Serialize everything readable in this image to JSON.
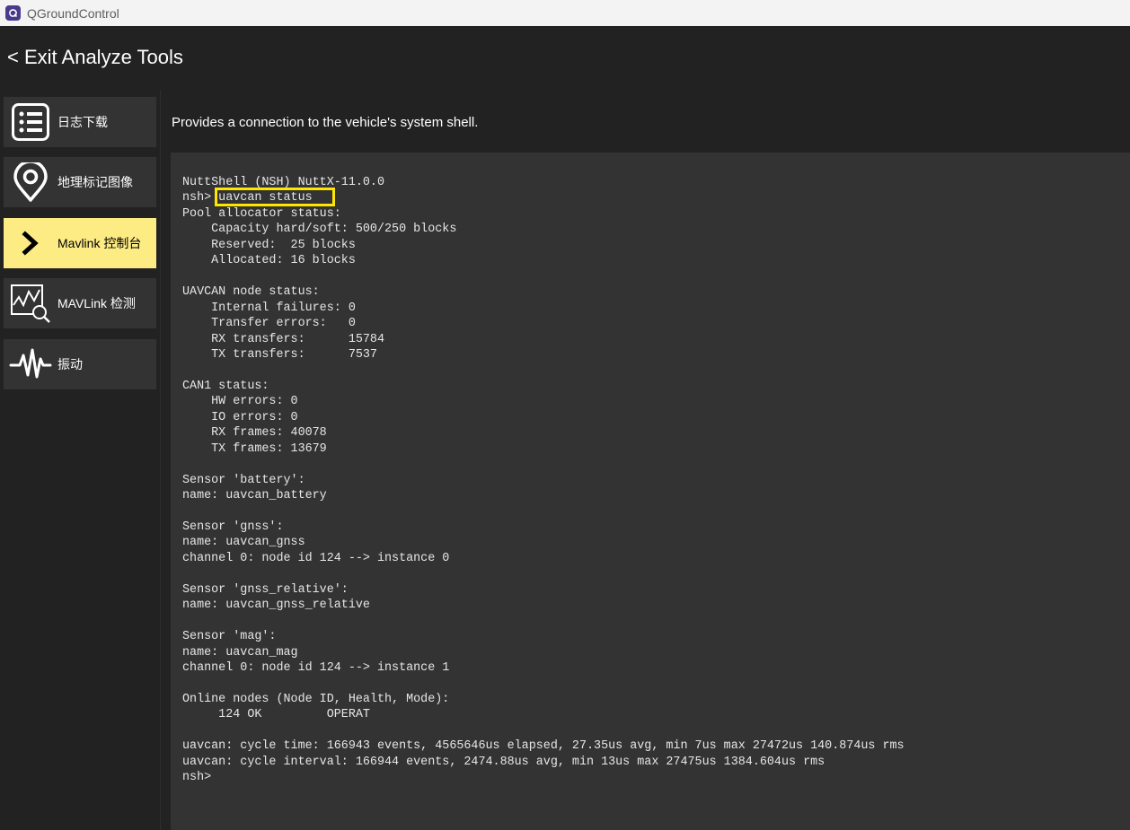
{
  "window": {
    "title": "QGroundControl"
  },
  "header": {
    "back_label": "< Exit Analyze Tools"
  },
  "sidebar": {
    "items": [
      {
        "label": "日志下载",
        "icon": "list-icon",
        "active": false
      },
      {
        "label": "地理标记图像",
        "icon": "map-pin-icon",
        "active": false
      },
      {
        "label": "Mavlink 控制台",
        "icon": "chevron-right-icon",
        "active": true
      },
      {
        "label": "MAVLink 检测",
        "icon": "chart-inspect-icon",
        "active": false
      },
      {
        "label": "振动",
        "icon": "waveform-icon",
        "active": false
      }
    ]
  },
  "main": {
    "description": "Provides a connection to the vehicle's system shell.",
    "highlighted_command": "uavcan status",
    "console_lines": [
      "NuttShell (NSH) NuttX-11.0.0",
      "nsh> uavcan status",
      "Pool allocator status:",
      "    Capacity hard/soft: 500/250 blocks",
      "    Reserved:  25 blocks",
      "    Allocated: 16 blocks",
      "",
      "UAVCAN node status:",
      "    Internal failures: 0",
      "    Transfer errors:   0",
      "    RX transfers:      15784",
      "    TX transfers:      7537",
      "",
      "CAN1 status:",
      "    HW errors: 0",
      "    IO errors: 0",
      "    RX frames: 40078",
      "    TX frames: 13679",
      "",
      "Sensor 'battery':",
      "name: uavcan_battery",
      "",
      "Sensor 'gnss':",
      "name: uavcan_gnss",
      "channel 0: node id 124 --> instance 0",
      "",
      "Sensor 'gnss_relative':",
      "name: uavcan_gnss_relative",
      "",
      "Sensor 'mag':",
      "name: uavcan_mag",
      "channel 0: node id 124 --> instance 1",
      "",
      "Online nodes (Node ID, Health, Mode):",
      "     124 OK         OPERAT",
      "",
      "uavcan: cycle time: 166943 events, 4565646us elapsed, 27.35us avg, min 7us max 27472us 140.874us rms",
      "uavcan: cycle interval: 166944 events, 2474.88us avg, min 13us max 27475us 1384.604us rms",
      "nsh>"
    ]
  },
  "colors": {
    "background": "#222222",
    "panel": "#333333",
    "active_nav": "#fdeb84",
    "highlight_border": "#ffe600",
    "text": "#ffffff"
  }
}
